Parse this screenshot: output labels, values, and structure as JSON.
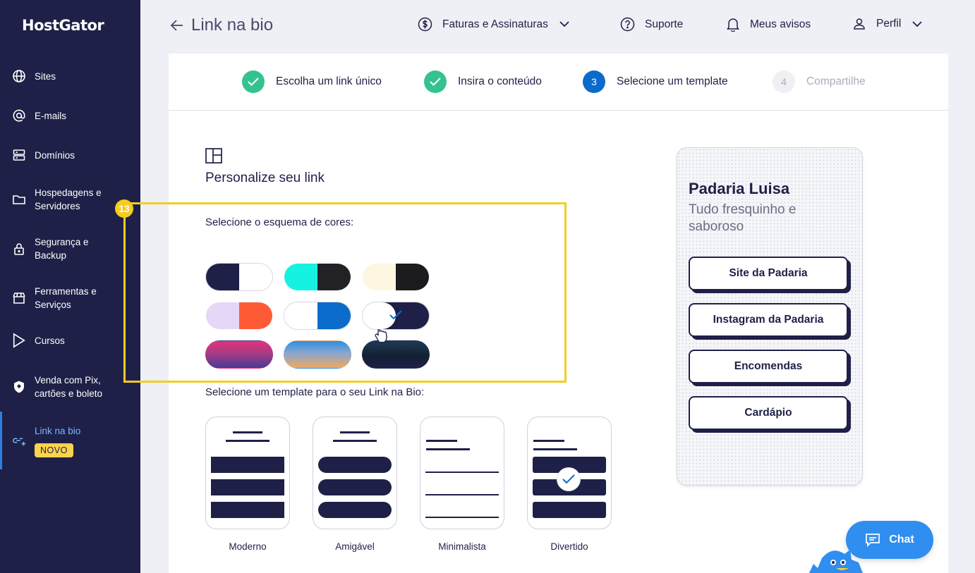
{
  "sidebar": {
    "logo": "HostGator",
    "items": [
      {
        "label": "Sites",
        "icon": "globe-icon"
      },
      {
        "label": "E-mails",
        "icon": "at-icon"
      },
      {
        "label": "Domínios",
        "icon": "server-icon"
      },
      {
        "label": "Hospedagens e Servidores",
        "icon": "folder-icon"
      },
      {
        "label": "Segurança e Backup",
        "icon": "lock-icon"
      },
      {
        "label": "Ferramentas e Serviços",
        "icon": "store-icon"
      },
      {
        "label": "Cursos",
        "icon": "play-icon"
      },
      {
        "label": "Venda com Pix, cartões e boleto",
        "icon": "shield-icon"
      },
      {
        "label": "Link na bio",
        "icon": "link-add-icon",
        "badge": "NOVO",
        "active": true
      }
    ]
  },
  "header": {
    "title": "Link na bio",
    "billing": "Faturas e Assinaturas",
    "support": "Suporte",
    "notices": "Meus avisos",
    "profile": "Perfil"
  },
  "stepper": [
    {
      "label": "Escolha um link único",
      "state": "done"
    },
    {
      "label": "Insira o conteúdo",
      "state": "done"
    },
    {
      "label": "Selecione um template",
      "state": "current",
      "number": "3"
    },
    {
      "label": "Compartilhe",
      "state": "pending",
      "number": "4"
    }
  ],
  "customize": {
    "title": "Personalize seu link",
    "color_label": "Selecione o esquema de cores:",
    "template_label": "Selecione um template para o seu Link na Bio:",
    "templates": [
      "Moderno",
      "Amigável",
      "Minimalista",
      "Divertido"
    ],
    "selected_scheme": 5,
    "selected_template": 3
  },
  "color_schemes": [
    [
      "#1f2048",
      "#ffffff"
    ],
    [
      "#16f2e2",
      "#222226"
    ],
    [
      "#fdf6e0",
      "#1b1b1d"
    ],
    [
      "#e5d7f5",
      "#ff5a36"
    ],
    [
      "#ffffff",
      "#0b6bcb"
    ],
    [
      "#ffffff",
      "#1f2048"
    ],
    [
      "gradient-magenta-purple"
    ],
    [
      "gradient-blue-orange"
    ],
    [
      "gradient-darknavy"
    ]
  ],
  "preview": {
    "title": "Padaria Luisa",
    "subtitle": "Tudo fresquinho e saboroso",
    "buttons": [
      "Site da Padaria",
      "Instagram da Padaria",
      "Encomendas",
      "Cardápio"
    ]
  },
  "annotation": {
    "number": "13",
    "color": "#f5cc20"
  },
  "chat": {
    "label": "Chat"
  },
  "colors": {
    "navy": "#1f2048",
    "accent": "#0b6bcb",
    "success": "#34c38f",
    "chat": "#2f8ef0"
  }
}
